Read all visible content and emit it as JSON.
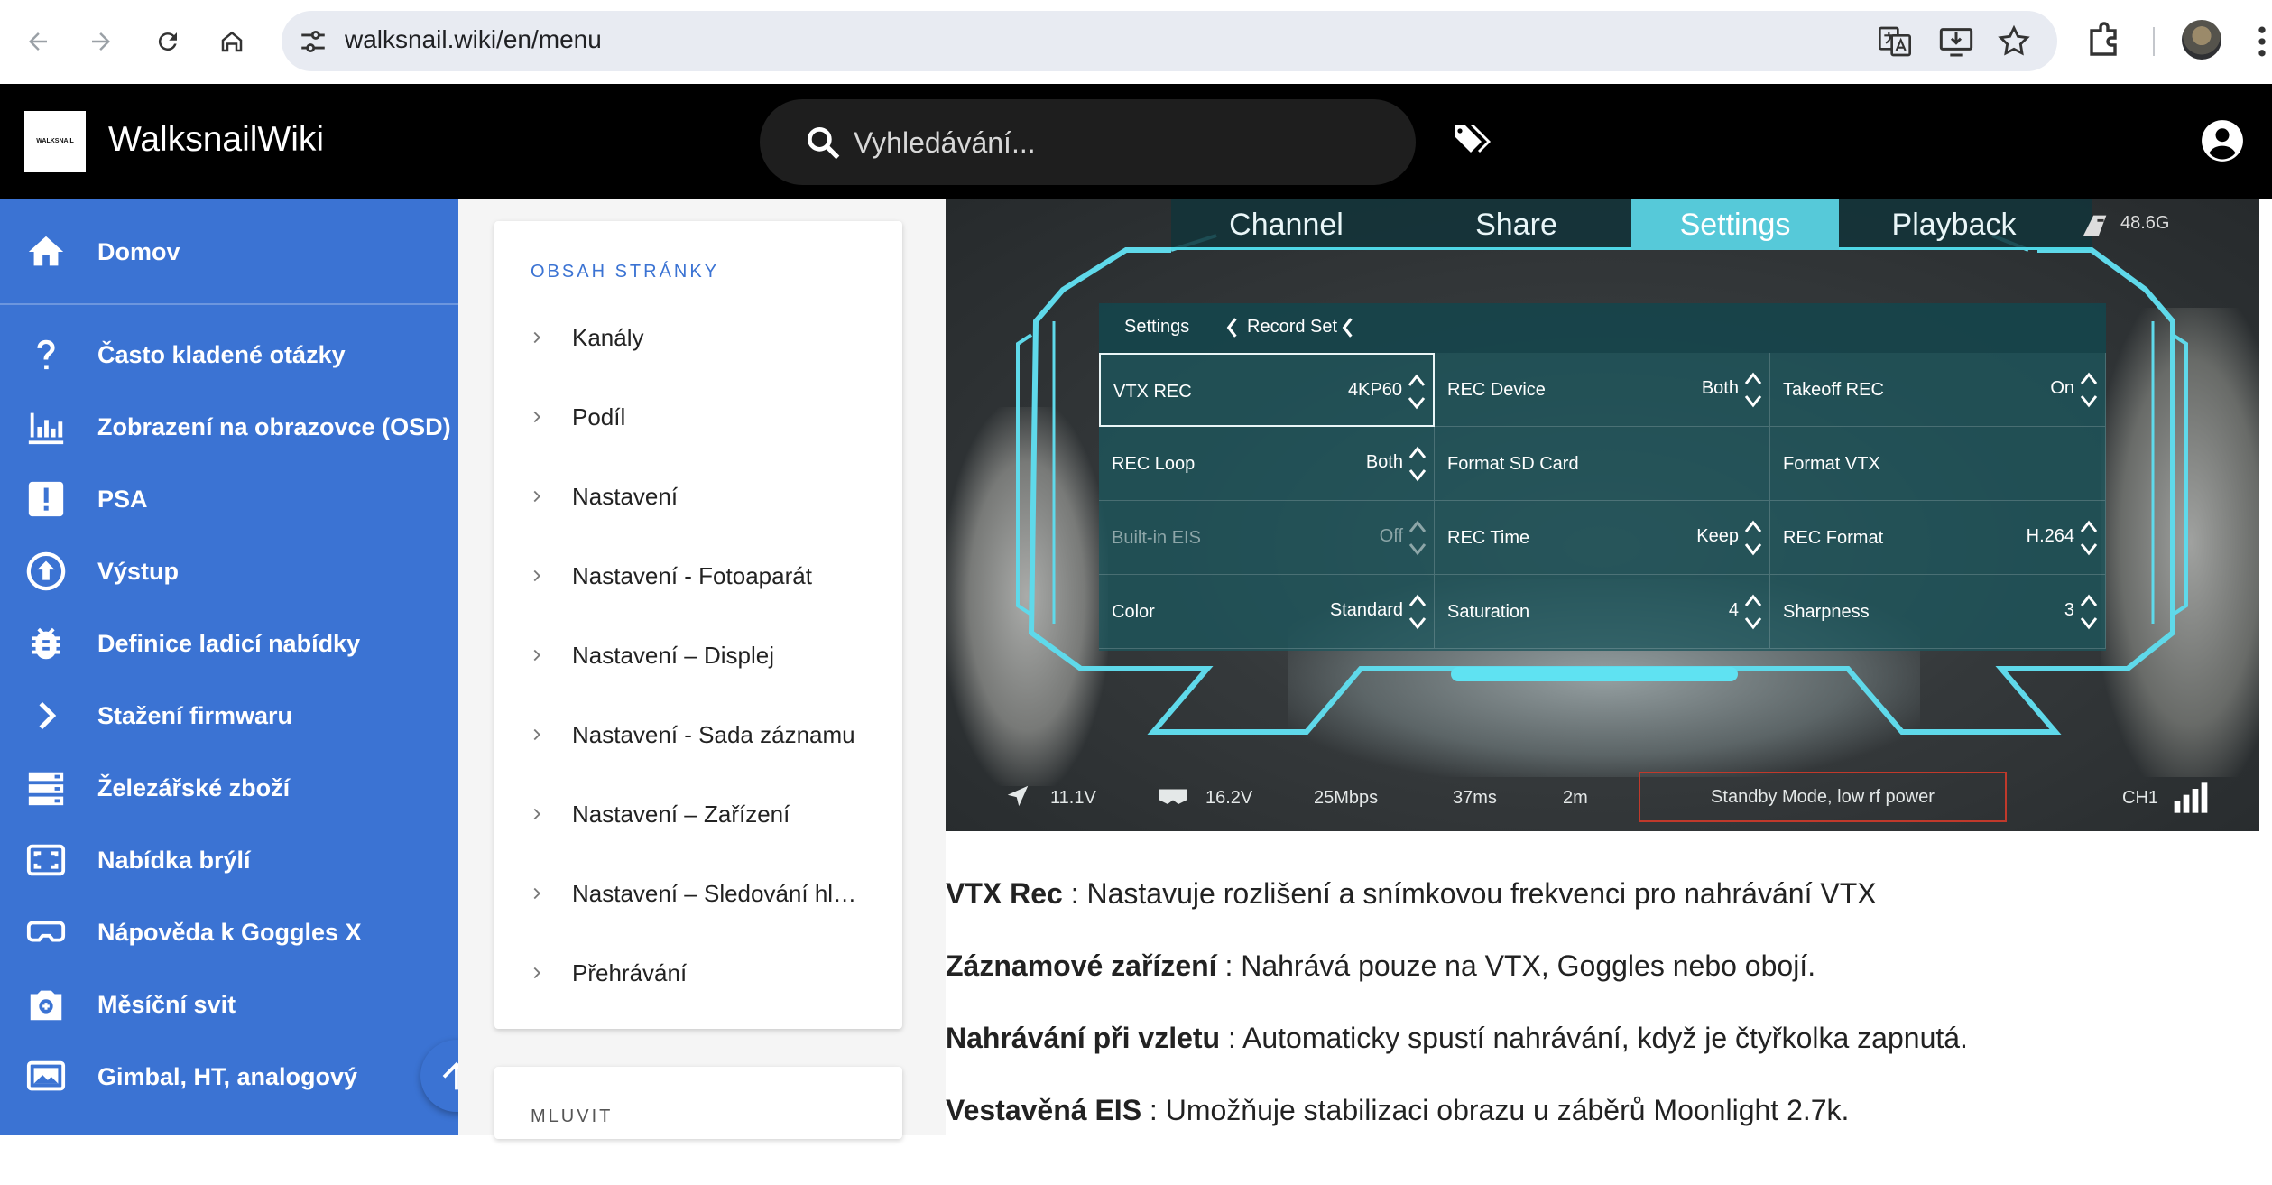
{
  "browser": {
    "url": "walksnail.wiki/en/menu"
  },
  "site": {
    "logo_text": "WALKSNAIL",
    "title": "WalksnailWiki",
    "search_placeholder": "Vyhledávání..."
  },
  "sidebar": {
    "items": [
      {
        "label": "Domov",
        "icon": "home-icon"
      },
      {
        "label": "Často kladené otázky",
        "icon": "question-icon"
      },
      {
        "label": "Zobrazení na obrazovce (OSD)",
        "icon": "bar-chart-icon"
      },
      {
        "label": "PSA",
        "icon": "alert-icon"
      },
      {
        "label": "Výstup",
        "icon": "upload-icon"
      },
      {
        "label": "Definice ladicí nabídky",
        "icon": "bug-icon"
      },
      {
        "label": "Stažení firmwaru",
        "icon": "chevron-right-icon"
      },
      {
        "label": "Železářské zboží",
        "icon": "server-icon"
      },
      {
        "label": "Nabídka brýlí",
        "icon": "fullscreen-icon"
      },
      {
        "label": "Nápověda k Goggles X",
        "icon": "goggles-icon"
      },
      {
        "label": "Měsíční svit",
        "icon": "camera-icon"
      },
      {
        "label": "Gimbal, HT, analogový",
        "icon": "monitor-icon"
      }
    ]
  },
  "toc": {
    "title": "OBSAH STRÁNKY",
    "items": [
      "Kanály",
      "Podíl",
      "Nastavení",
      "Nastavení - Fotoaparát",
      "Nastavení – Displej",
      "Nastavení - Sada záznamu",
      "Nastavení – Zařízení",
      "Nastavení – Sledování hlavy",
      "Přehrávání"
    ],
    "second_title": "MLUVIT"
  },
  "screenshot": {
    "tabs": [
      "Channel",
      "Share",
      "Settings",
      "Playback"
    ],
    "active_tab": "Settings",
    "storage": "48.6G",
    "breadcrumb": [
      "Settings",
      "Record Set"
    ],
    "cells": [
      {
        "label": "VTX REC",
        "value": "4KP60",
        "disabled": false,
        "selected": true
      },
      {
        "label": "REC Device",
        "value": "Both",
        "disabled": false,
        "selected": false
      },
      {
        "label": "Takeoff REC",
        "value": "On",
        "disabled": false,
        "selected": false
      },
      {
        "label": "REC Loop",
        "value": "Both",
        "disabled": false,
        "selected": false
      },
      {
        "label": "Format SD Card",
        "value": "",
        "disabled": false,
        "selected": false
      },
      {
        "label": "Format VTX",
        "value": "",
        "disabled": false,
        "selected": false
      },
      {
        "label": "Built-in EIS",
        "value": "Off",
        "disabled": true,
        "selected": false
      },
      {
        "label": "REC Time",
        "value": "Keep",
        "disabled": false,
        "selected": false
      },
      {
        "label": "REC Format",
        "value": "H.264",
        "disabled": false,
        "selected": false
      },
      {
        "label": "Color",
        "value": "Standard",
        "disabled": false,
        "selected": false
      },
      {
        "label": "Saturation",
        "value": "4",
        "disabled": false,
        "selected": false
      },
      {
        "label": "Sharpness",
        "value": "3",
        "disabled": false,
        "selected": false
      }
    ],
    "status": {
      "voltage1": "11.1V",
      "voltage2": "16.2V",
      "bitrate": "25Mbps",
      "latency": "37ms",
      "time": "2m",
      "mode": "Standby Mode, low rf power",
      "channel": "CH1"
    }
  },
  "paragraphs": [
    {
      "term": "VTX Rec",
      "text": " : Nastavuje rozlišení a snímkovou frekvenci pro nahrávání VTX"
    },
    {
      "term": "Záznamové zařízení",
      "text": " : Nahrává pouze na VTX, Goggles nebo obojí."
    },
    {
      "term": "Nahrávání při vzletu",
      "text": " : Automaticky spustí nahrávání, když je čtyřkolka zapnutá."
    },
    {
      "term": "Vestavěná EIS",
      "text": " : Umožňuje stabilizaci obrazu u záběrů Moonlight 2.7k."
    }
  ],
  "colors": {
    "sidebar": "#3b73d3",
    "topbar": "#000000",
    "accent_cyan": "#56c9d9"
  }
}
